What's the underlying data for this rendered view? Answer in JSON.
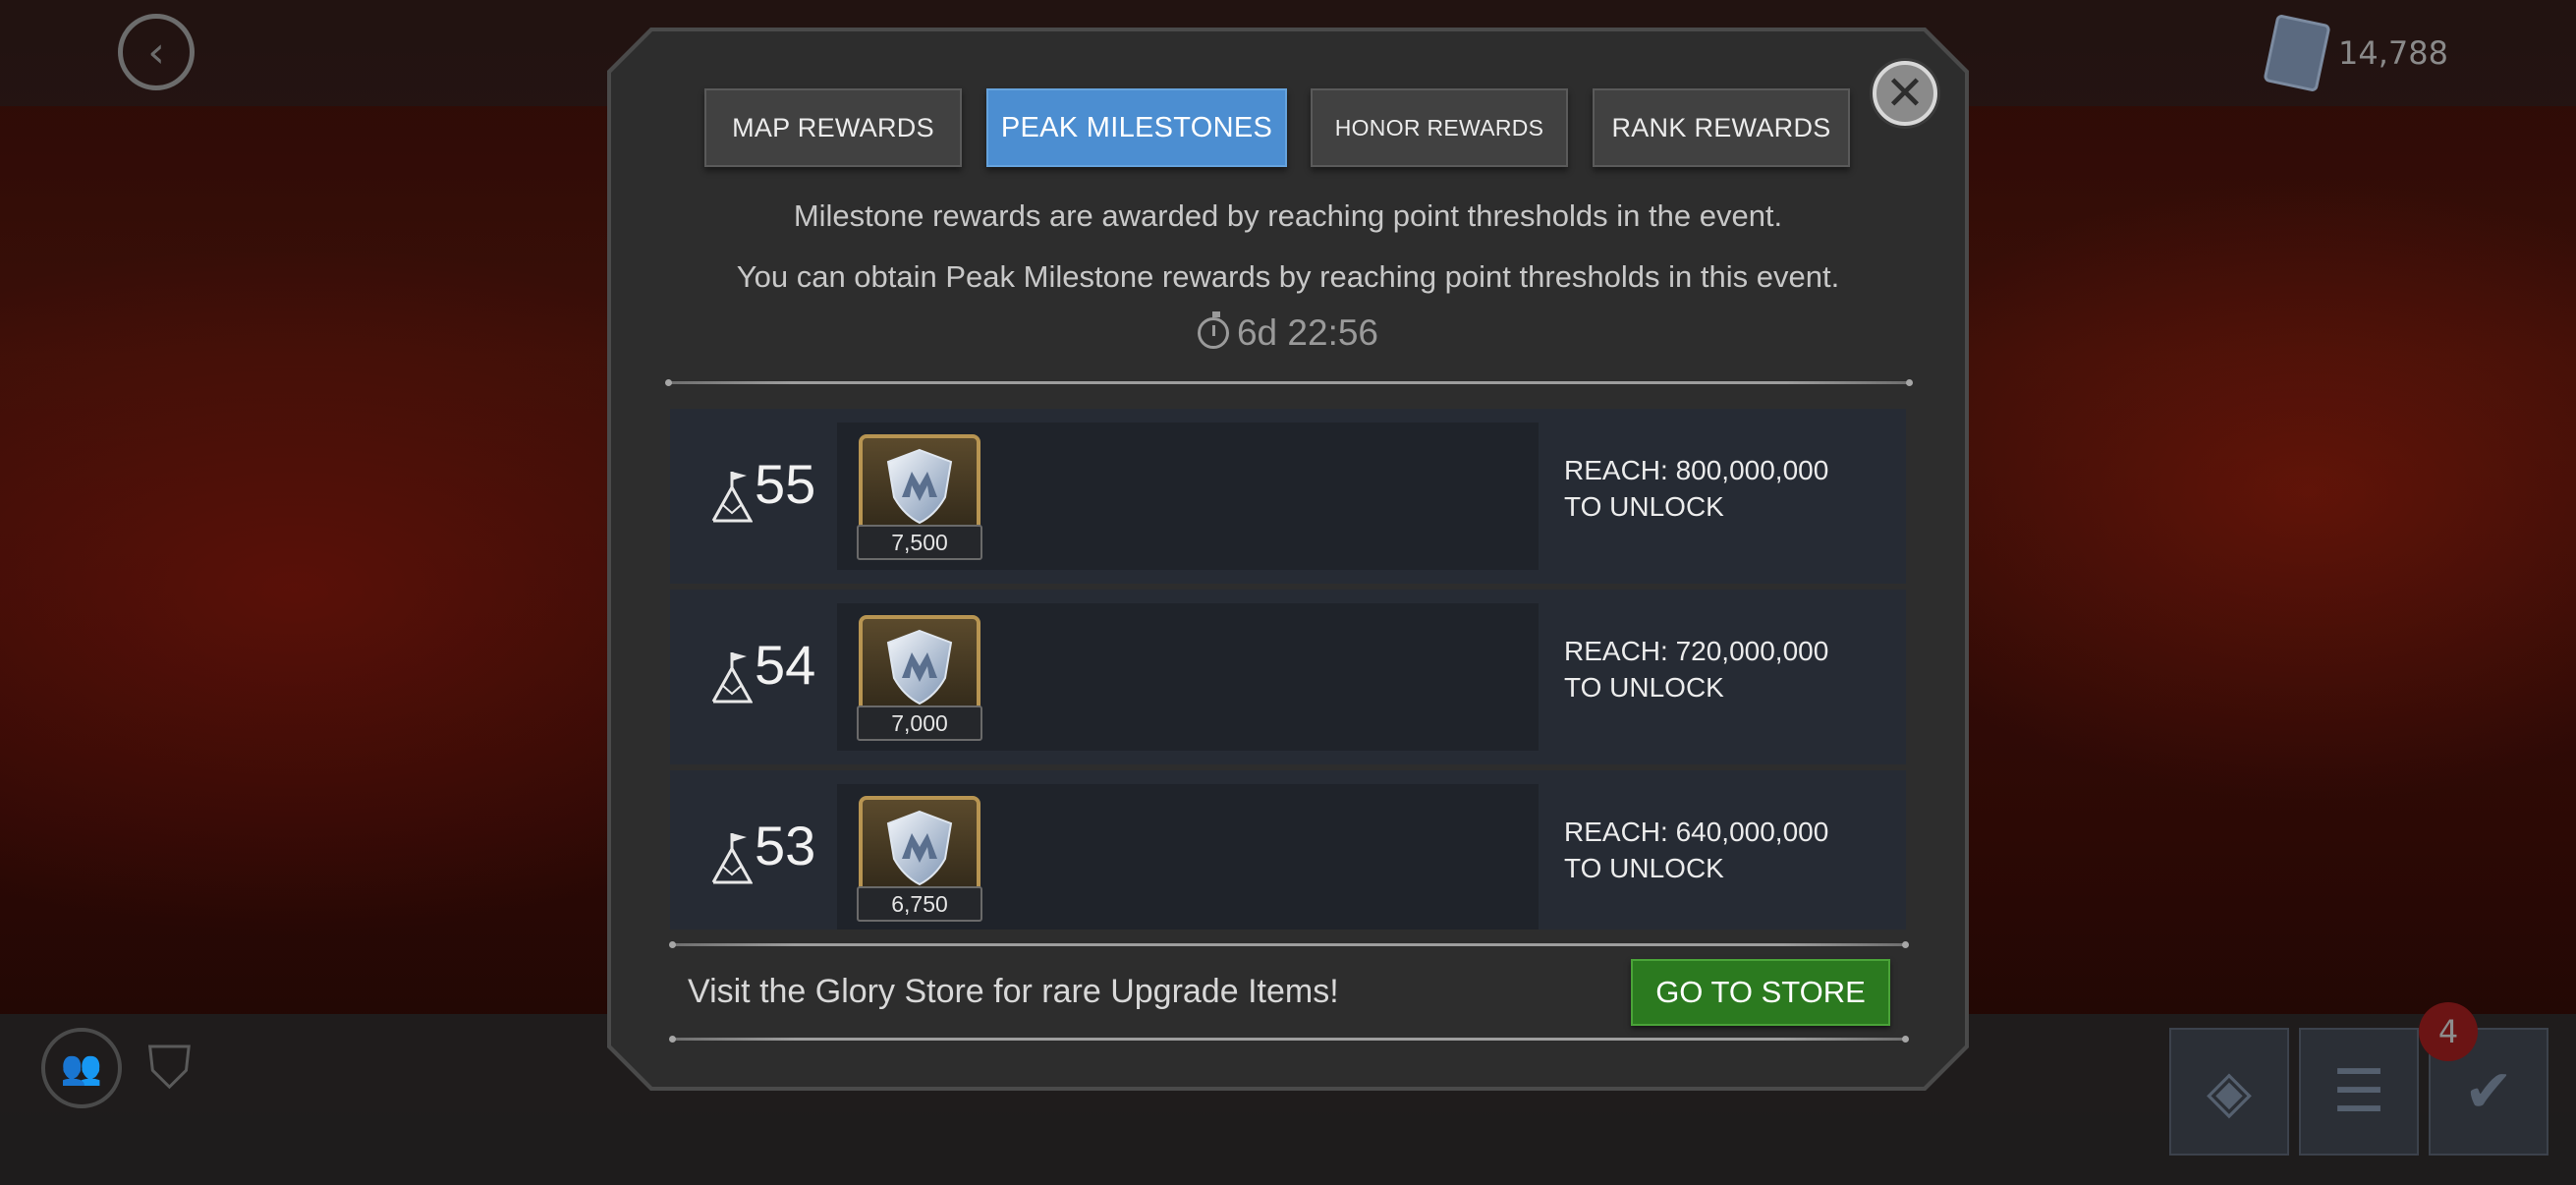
{
  "background": {
    "currency_amount": "14,788",
    "notification_count": "4"
  },
  "tabs": [
    {
      "label": "MAP REWARDS",
      "active": false
    },
    {
      "label": "PEAK MILESTONES",
      "active": true
    },
    {
      "label": "HONOR REWARDS",
      "active": false
    },
    {
      "label": "RANK REWARDS",
      "active": false
    }
  ],
  "description": {
    "line1": "Milestone rewards are awarded by reaching point thresholds in the event.",
    "line2": "You can obtain Peak Milestone rewards by reaching point thresholds in this event."
  },
  "timer": "6d 22:56",
  "milestones": [
    {
      "tier": "55",
      "reward_amount": "7,500",
      "reach": "REACH: 800,000,000",
      "unlock": "TO UNLOCK",
      "reward_icon": "glory-shield-icon"
    },
    {
      "tier": "54",
      "reward_amount": "7,000",
      "reach": "REACH: 720,000,000",
      "unlock": "TO UNLOCK",
      "reward_icon": "glory-shield-icon"
    },
    {
      "tier": "53",
      "reward_amount": "6,750",
      "reach": "REACH: 640,000,000",
      "unlock": "TO UNLOCK",
      "reward_icon": "glory-shield-icon"
    }
  ],
  "footer": {
    "text": "Visit the Glory Store for rare Upgrade Items!",
    "button_label": "GO TO STORE"
  },
  "colors": {
    "active_tab": "#4c8ed1",
    "store_button": "#2b7a1f",
    "row_background": "#262b34",
    "reward_frame": "#b89552"
  }
}
